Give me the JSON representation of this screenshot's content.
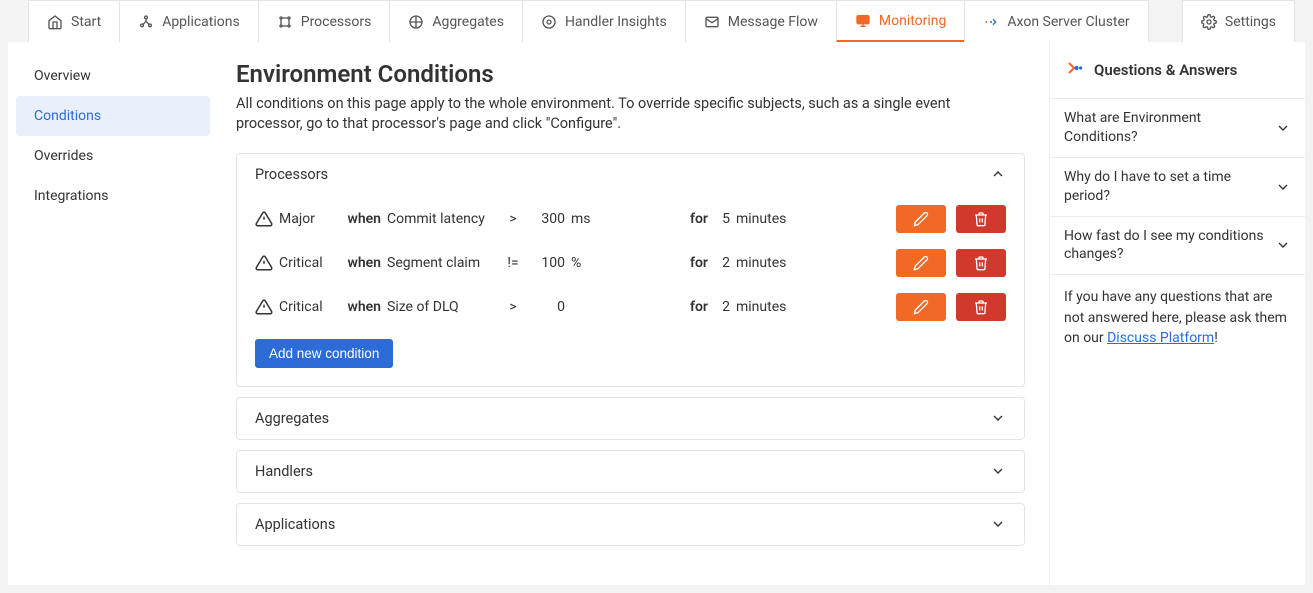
{
  "nav": {
    "tabs": [
      {
        "label": "Start"
      },
      {
        "label": "Applications"
      },
      {
        "label": "Processors"
      },
      {
        "label": "Aggregates"
      },
      {
        "label": "Handler Insights"
      },
      {
        "label": "Message Flow"
      },
      {
        "label": "Monitoring"
      },
      {
        "label": "Axon Server Cluster"
      }
    ],
    "settings": "Settings"
  },
  "sidebar": {
    "items": [
      "Overview",
      "Conditions",
      "Overrides",
      "Integrations"
    ]
  },
  "main": {
    "title": "Environment Conditions",
    "description": "All conditions on this page apply to the whole environment. To override specific subjects, such as a single event processor, go to that processor's page and click \"Configure\"."
  },
  "labels": {
    "when": "when",
    "for": "for",
    "add": "Add new condition"
  },
  "panels": {
    "processors": {
      "title": "Processors",
      "rows": [
        {
          "sev": "Major",
          "metric": "Commit latency",
          "op": ">",
          "val": "300",
          "unit": "ms",
          "dv": "5",
          "du": "minutes"
        },
        {
          "sev": "Critical",
          "metric": "Segment claim",
          "op": "!=",
          "val": "100",
          "unit": "%",
          "dv": "2",
          "du": "minutes"
        },
        {
          "sev": "Critical",
          "metric": "Size of DLQ",
          "op": ">",
          "val": "0",
          "unit": "",
          "dv": "2",
          "du": "minutes"
        }
      ]
    },
    "aggregates": {
      "title": "Aggregates"
    },
    "handlers": {
      "title": "Handlers"
    },
    "applications": {
      "title": "Applications"
    }
  },
  "qa": {
    "title": "Questions & Answers",
    "faqs": [
      "What are Environment Conditions?",
      "Why do I have to set a time period?",
      "How fast do I see my conditions changes?"
    ],
    "foot_pre": "If you have any questions that are not answered here, please ask them on our ",
    "foot_link": "Discuss Platform",
    "foot_post": "!"
  }
}
